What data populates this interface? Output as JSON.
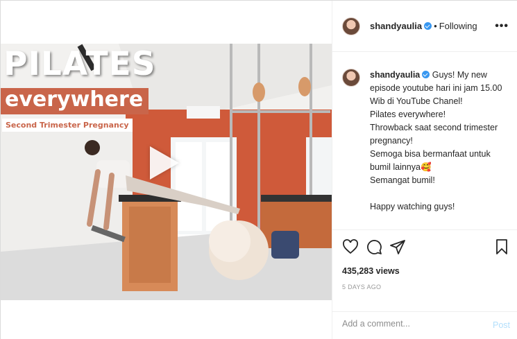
{
  "video": {
    "title_line1": "PILATES",
    "title_line2": "everywhere",
    "tag": "Second Trimester Pregnancy"
  },
  "header": {
    "username": "shandyaulia",
    "separator": "•",
    "follow_status": "Following",
    "more_label": "•••"
  },
  "caption": {
    "username": "shandyaulia",
    "lines": [
      "Guys! My new episode youtube hari ini jam 15.00 Wib di YouTube Chanel!",
      "Pilates everywhere!",
      "Throwback saat second trimester pregnancy!",
      "Semoga bisa bermanfaat untuk bumil lainnya🥰",
      "Semangat bumil!",
      "",
      "Happy watching guys!"
    ]
  },
  "stats": {
    "views": "435,283 views",
    "time_ago": "5 DAYS AGO"
  },
  "comment": {
    "placeholder": "Add a comment...",
    "post_label": "Post"
  },
  "colors": {
    "accent": "#3897f0",
    "post_disabled": "#b2dffc",
    "wall_orange": "#cf5a3a"
  }
}
